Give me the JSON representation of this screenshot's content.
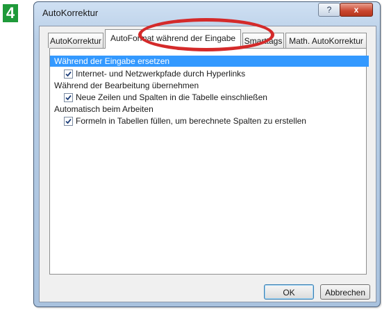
{
  "step_number": "4",
  "window": {
    "title": "AutoKorrektur",
    "help_label": "?",
    "close_label": "x"
  },
  "tabs": [
    {
      "label": "AutoKorrektur"
    },
    {
      "label": "AutoFormat während der Eingabe"
    },
    {
      "label": "Smarttags"
    },
    {
      "label": "Math. AutoKorrektur"
    }
  ],
  "options": [
    {
      "label": "Während der Eingabe ersetzen",
      "type": "header",
      "selected": true
    },
    {
      "label": "Internet- und Netzwerkpfade durch Hyperlinks",
      "type": "checkbox",
      "checked": true
    },
    {
      "label": "Während der Bearbeitung übernehmen",
      "type": "header"
    },
    {
      "label": "Neue Zeilen und Spalten in die Tabelle einschließen",
      "type": "checkbox",
      "checked": true
    },
    {
      "label": "Automatisch beim Arbeiten",
      "type": "header"
    },
    {
      "label": "Formeln in Tabellen füllen, um berechnete Spalten zu erstellen",
      "type": "checkbox",
      "checked": true
    }
  ],
  "buttons": {
    "ok": "OK",
    "cancel": "Abbrechen"
  },
  "colors": {
    "highlight_oval": "#d42a2a",
    "selection": "#3399ff",
    "step_badge": "#1f9a3a"
  }
}
